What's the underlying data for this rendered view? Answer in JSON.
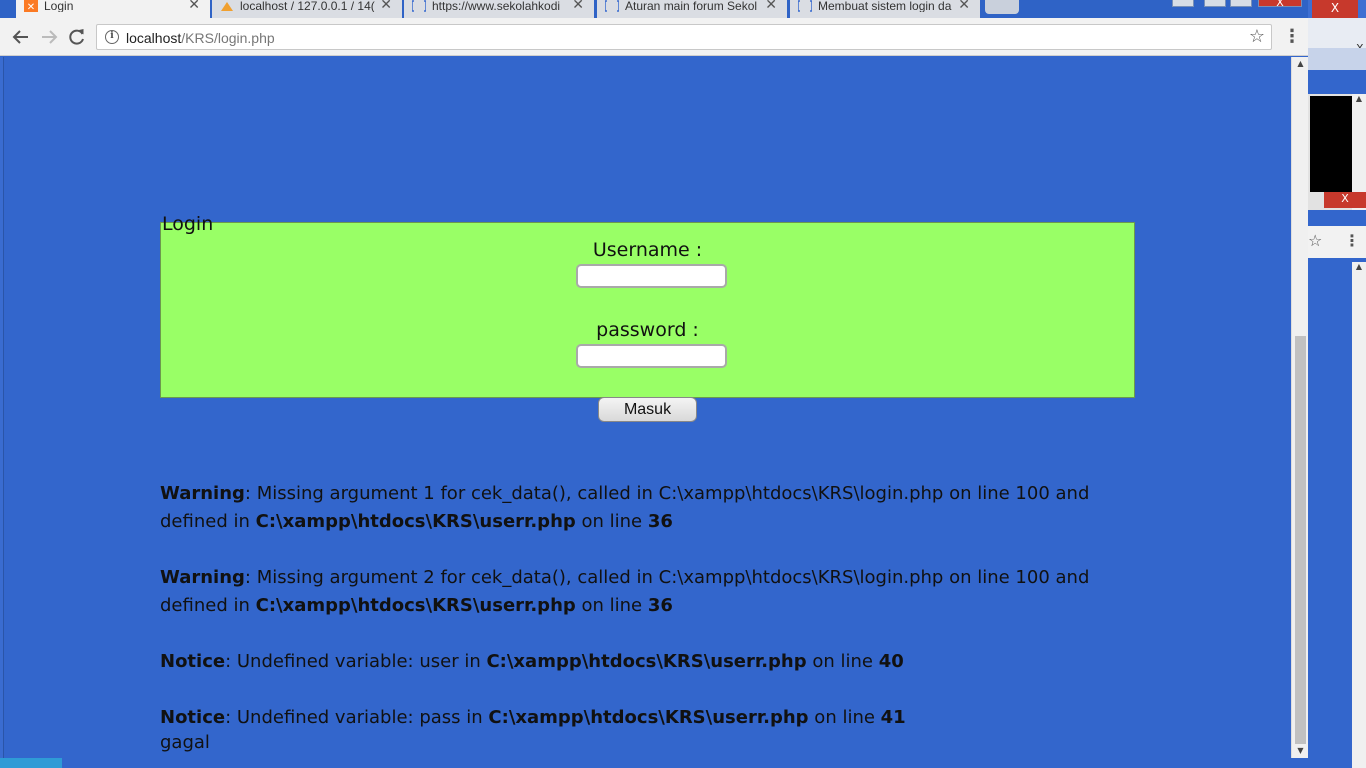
{
  "browser": {
    "tabs": [
      {
        "label": "Login",
        "icon": "xampp-icon",
        "active": true
      },
      {
        "label": "localhost / 127.0.0.1 / 14(",
        "icon": "phpmyadmin-icon",
        "active": false
      },
      {
        "label": "https://www.sekolahkodi",
        "icon": "page-icon",
        "active": false
      },
      {
        "label": "Aturan main forum Sekol",
        "icon": "page-icon",
        "active": false
      },
      {
        "label": "Membuat sistem login da",
        "icon": "page-icon",
        "active": false
      }
    ],
    "tab_close_glyph": "✕",
    "url_host": "localhost",
    "url_path": "/KRS/login.php",
    "window_close_glyph": "X"
  },
  "page": {
    "legend": "Login",
    "username_label": "Username :",
    "username_value": "",
    "password_label": "password :",
    "password_value": "",
    "submit_label": "Masuk",
    "errors": [
      {
        "level": "Warning",
        "text": ": Missing argument 1 for cek_data(), called in C:\\xampp\\htdocs\\KRS\\login.php on line 100 and defined in ",
        "file": "C:\\xampp\\htdocs\\KRS\\userr.php",
        "mid": " on line ",
        "line": "36"
      },
      {
        "level": "Warning",
        "text": ": Missing argument 2 for cek_data(), called in C:\\xampp\\htdocs\\KRS\\login.php on line 100 and defined in ",
        "file": "C:\\xampp\\htdocs\\KRS\\userr.php",
        "mid": " on line ",
        "line": "36"
      },
      {
        "level": "Notice",
        "text": ": Undefined variable: user in ",
        "file": "C:\\xampp\\htdocs\\KRS\\userr.php",
        "mid": " on line ",
        "line": "40"
      },
      {
        "level": "Notice",
        "text": ": Undefined variable: pass in ",
        "file": "C:\\xampp\\htdocs\\KRS\\userr.php",
        "mid": " on line ",
        "line": "41"
      }
    ],
    "result": "gagal",
    "background_color": "#3366cc",
    "box_color": "#99ff66"
  },
  "background_window": {
    "close_glyph": "X",
    "close_glyph_small": "X"
  }
}
